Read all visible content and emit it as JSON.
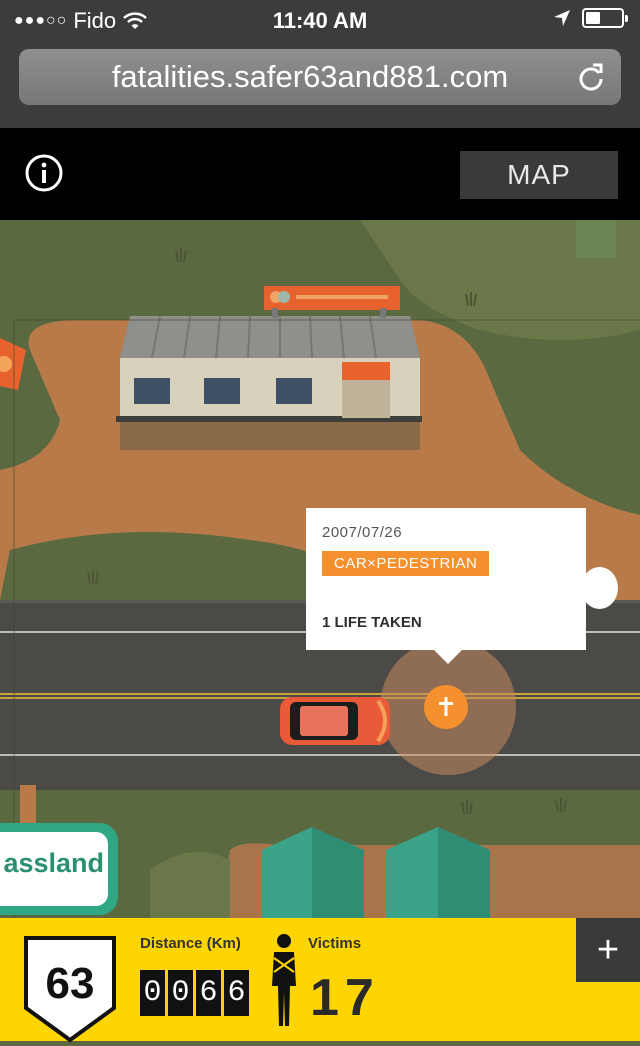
{
  "status_bar": {
    "signal_dots": "●●●○○",
    "carrier": "Fido",
    "time": "11:40 AM",
    "icons": [
      "wifi-icon",
      "location-arrow-icon",
      "battery-icon"
    ]
  },
  "browser": {
    "url": "fatalities.safer63and881.com",
    "reload_icon": "reload-icon"
  },
  "app_bar": {
    "info_icon": "info-icon",
    "map_label": "MAP"
  },
  "scene": {
    "sign_text": "assland"
  },
  "popup": {
    "date": "2007/07/26",
    "type": "CAR×PEDESTRIAN",
    "lives": "1 LIFE TAKEN"
  },
  "bottom_bar": {
    "route_number": "63",
    "distance_label": "Distance (Km)",
    "distance_digits": [
      "0",
      "0",
      "6",
      "6"
    ],
    "victims_label": "Victims",
    "victims_count": "17",
    "plus_label": "+"
  },
  "colors": {
    "accent_orange": "#f5902e",
    "bar_yellow": "#ffd500",
    "grass": "#5c6a42",
    "road": "#4a4a47"
  }
}
